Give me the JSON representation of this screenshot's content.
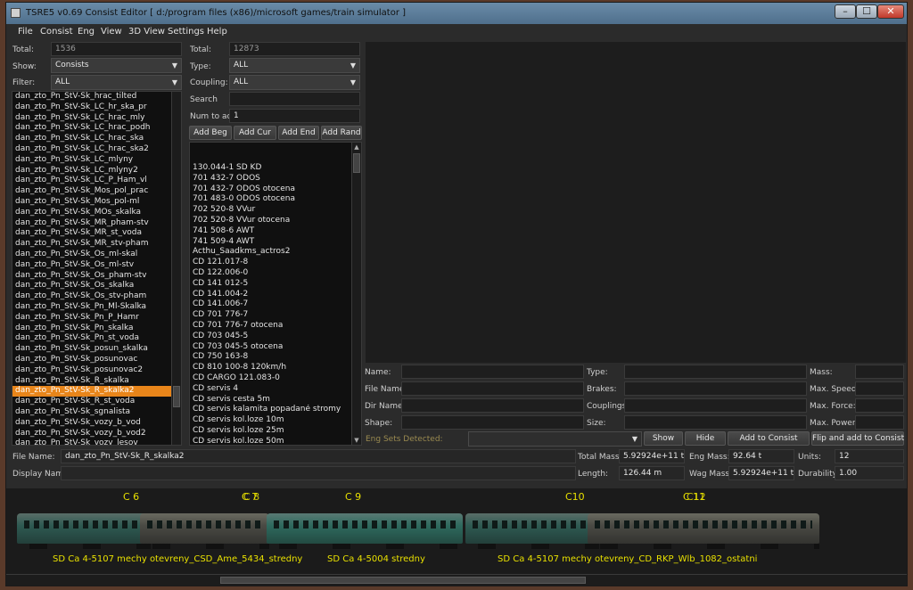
{
  "window": {
    "title": "TSRE5 v0.69 Consist Editor   [ d:/program files (x86)/microsoft games/train simulator ]",
    "controls": {
      "minimize": "–",
      "maximize": "☐",
      "close": "✕"
    }
  },
  "menu": [
    "File",
    "Consist",
    "Eng",
    "View",
    "3D View",
    "Settings",
    "Help"
  ],
  "left_panel": {
    "total_label": "Total:",
    "total_value": "1536",
    "show_label": "Show:",
    "show_value": "Consists",
    "filter_label": "Filter:",
    "filter_value": "ALL",
    "items": [
      "dan_zto_Pn_StV-Sk_hrac_tilted",
      "dan_zto_Pn_StV-Sk_LC_hr_ska_pr",
      "dan_zto_Pn_StV-Sk_LC_hrac_mly",
      "dan_zto_Pn_StV-Sk_LC_hrac_podh",
      "dan_zto_Pn_StV-Sk_LC_hrac_ska",
      "dan_zto_Pn_StV-Sk_LC_hrac_ska2",
      "dan_zto_Pn_StV-Sk_LC_mlyny",
      "dan_zto_Pn_StV-Sk_LC_mlyny2",
      "dan_zto_Pn_StV-Sk_LC_P_Ham_vl",
      "dan_zto_Pn_StV-Sk_Mos_pol_prac",
      "dan_zto_Pn_StV-Sk_Mos_pol-ml",
      "dan_zto_Pn_StV-Sk_MOs_skalka",
      "dan_zto_Pn_StV-Sk_MR_pham-stv",
      "dan_zto_Pn_StV-Sk_MR_st_voda",
      "dan_zto_Pn_StV-Sk_MR_stv-pham",
      "dan_zto_Pn_StV-Sk_Os_ml-skal",
      "dan_zto_Pn_StV-Sk_Os_ml-stv",
      "dan_zto_Pn_StV-Sk_Os_pham-stv",
      "dan_zto_Pn_StV-Sk_Os_skalka",
      "dan_zto_Pn_StV-Sk_Os_stv-pham",
      "dan_zto_Pn_StV-Sk_Pn_Ml-Skalka",
      "dan_zto_Pn_StV-Sk_Pn_P_Hamr",
      "dan_zto_Pn_StV-Sk_Pn_skalka",
      "dan_zto_Pn_StV-Sk_Pn_st_voda",
      "dan_zto_Pn_StV-Sk_posun_skalka",
      "dan_zto_Pn_StV-Sk_posunovac",
      "dan_zto_Pn_StV-Sk_posunovac2",
      "dan_zto_Pn_StV-Sk_R_skalka",
      "dan_zto_Pn_StV-Sk_R_skalka2",
      "dan_zto_Pn_StV-Sk_R_st_voda",
      "dan_zto_Pn_StV-Sk_sgnalista",
      "dan_zto_Pn_StV-Sk_vozy_b_vod",
      "dan_zto_Pn_StV-Sk_vozy_b_vod2",
      "dan_zto_Pn_StV-Sk_vozy_lesov"
    ],
    "selected_index": 28
  },
  "mid_panel": {
    "total_label": "Total:",
    "total_value": "12873",
    "type_label": "Type:",
    "type_value": "ALL",
    "coupling_label": "Coupling:",
    "coupling_value": "ALL",
    "search_label": "Search",
    "search_value": "",
    "num_label": "Num to add",
    "num_value": "1",
    "buttons": [
      "Add Beg",
      "Add Cur",
      "Add End",
      "Add Rand"
    ],
    "items": [
      "130.044-1 SD KD",
      "701 432-7 ODOS",
      "701 432-7 ODOS otocena",
      "701 483-0 ODOS otocena",
      "702 520-8 VVur",
      "702 520-8 VVur otocena",
      "741 508-6 AWT",
      "741 509-4 AWT",
      "Acthu_Saadkms_actros2",
      "CD 121.017-8",
      "CD 122.006-0",
      "CD 141 012-5",
      "CD 141.004-2",
      "CD 141.006-7",
      "CD 701 776-7",
      "CD 701 776-7 otocena",
      "CD 703 045-5",
      "CD 703 045-5 otocena",
      "CD 750 163-8",
      "CD 810 100-8 120km/h",
      "CD CARGO 121.083-0",
      "CD servis 4",
      "CD servis cesta 5m",
      "CD servis kalamita popadané stromy",
      "CD servis kol.loze 10m",
      "CD servis kol.loze 25m",
      "CD servis kol.loze 50m"
    ]
  },
  "eng_info": {
    "name_label": "Name:",
    "filename_label": "File Name:",
    "dirname_label": "Dir Name:",
    "shape_label": "Shape:",
    "type_label": "Type:",
    "brakes_label": "Brakes:",
    "couplings_label": "Couplings:",
    "size_label": "Size:",
    "mass_label": "Mass:",
    "maxspeed_label": "Max. Speed:",
    "maxforce_label": "Max. Force:",
    "maxpower_label": "Max. Power:",
    "engsets_label": "Eng Sets Detected:",
    "show_button": "Show",
    "hide_button": "Hide",
    "add_consist_button": "Add to Consist",
    "flip_add_button": "Flip and add to Consist"
  },
  "consist_info": {
    "filename_label": "File Name:",
    "filename_value": "dan_zto_Pn_StV-Sk_R_skalka2",
    "displayname_label": "Display Name:",
    "displayname_value": "",
    "totalmass_label": "Total Mass:",
    "totalmass_value": "5.92924e+11 t",
    "engmass_label": "Eng Mass:",
    "engmass_value": "92.64 t",
    "units_label": "Units:",
    "units_value": "12",
    "length_label": "Length:",
    "length_value": "126.44 m",
    "wagmass_label": "Wag Mass:",
    "wagmass_value": "5.92924e+11 t",
    "durability_label": "Durability:",
    "durability_value": "1.00"
  },
  "train_view": {
    "car_labels": [
      "C 6",
      "C 7",
      "C 8",
      "C 9",
      "C10",
      "C 11",
      "C12"
    ],
    "car_names": [
      "SD Ca 4-5107 mechy otevreny_CSD_Ame_5434_stredny",
      "SD Ca 4-5004 stredny",
      "SD Ca 4-5107 mechy otevreny_CD_RKP_Wlb_1082_ostatni"
    ],
    "colors": {
      "green_car": "#2e5a52",
      "grey_car": "#4a4a44",
      "label": "#e8e000"
    }
  }
}
